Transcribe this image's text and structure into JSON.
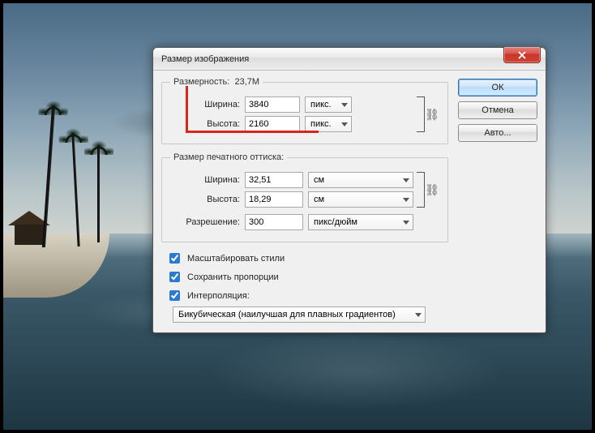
{
  "dialog": {
    "title": "Размер изображения",
    "dimensions": {
      "legend": "Размерность:",
      "size_value": "23,7M",
      "width_label": "Ширина:",
      "width_value": "3840",
      "width_unit": "пикс.",
      "height_label": "Высота:",
      "height_value": "2160",
      "height_unit": "пикс."
    },
    "print": {
      "legend": "Размер печатного оттиска:",
      "width_label": "Ширина:",
      "width_value": "32,51",
      "width_unit": "см",
      "height_label": "Высота:",
      "height_value": "18,29",
      "height_unit": "см",
      "res_label": "Разрешение:",
      "res_value": "300",
      "res_unit": "пикс/дюйм"
    },
    "checks": {
      "scale_styles": "Масштабировать стили",
      "keep_aspect": "Сохранить пропорции",
      "interpolation": "Интерполяция:"
    },
    "interp_method": "Бикубическая (наилучшая для плавных градиентов)",
    "buttons": {
      "ok": "ОК",
      "cancel": "Отмена",
      "auto": "Авто..."
    }
  }
}
